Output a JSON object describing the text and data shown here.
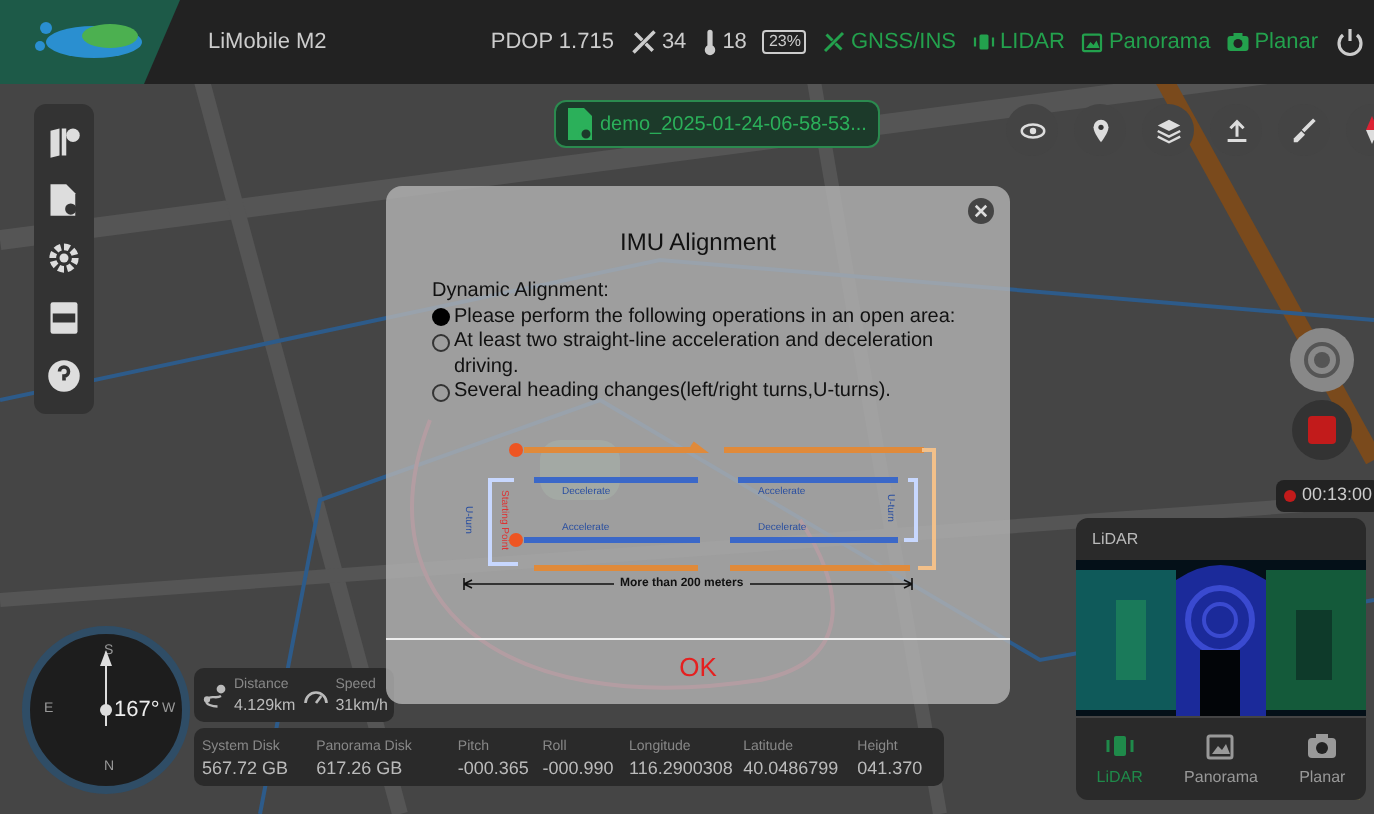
{
  "top_bar": {
    "device": "LiMobile M2",
    "pdop": "PDOP 1.715",
    "satellites": "34",
    "temperature": "18",
    "battery": "23%",
    "modes": [
      {
        "label": "GNSS/INS"
      },
      {
        "label": "LIDAR"
      },
      {
        "label": "Panorama"
      },
      {
        "label": "Planar"
      }
    ]
  },
  "file_chip": "demo_2025-01-24-06-58-53...",
  "recording": {
    "time": "00:13:00"
  },
  "dialog": {
    "title": "IMU Alignment",
    "heading": "Dynamic Alignment:",
    "items": [
      {
        "text": "Please perform the following operations in an open area:",
        "selected": true
      },
      {
        "text": "At least two straight-line acceleration and deceleration driving.",
        "selected": false
      },
      {
        "text": "Several heading changes(left/right turns,U-turns).",
        "selected": false
      }
    ],
    "diagram_labels": {
      "row_2_left": "Decelerate",
      "row_2_right": "Accelerate",
      "row_3_left": "Accelerate",
      "row_3_right": "Decelerate",
      "left_turn": "U-turn",
      "start": "Starting Point",
      "right_turn": "U-turn",
      "distance": "More than 200 meters"
    },
    "button": "OK"
  },
  "compass": {
    "heading": "167°",
    "cardinals": [
      "S",
      "E",
      "W",
      "N"
    ]
  },
  "trip": {
    "distance_label": "Distance",
    "distance": "4.129km",
    "speed_label": "Speed",
    "speed": "31km/h"
  },
  "stats": [
    {
      "label": "System Disk",
      "value": "567.72 GB"
    },
    {
      "label": "Panorama Disk",
      "value": "617.26 GB"
    },
    {
      "label": "Pitch",
      "value": "-000.365"
    },
    {
      "label": "Roll",
      "value": "-000.990"
    },
    {
      "label": "Longitude",
      "value": "116.2900308"
    },
    {
      "label": "Latitude",
      "value": "40.0486799"
    },
    {
      "label": "Height",
      "value": "041.370"
    }
  ],
  "lidar_panel": {
    "title": "LiDAR",
    "tabs": [
      {
        "label": "LiDAR",
        "selected": true
      },
      {
        "label": "Panorama",
        "selected": false
      },
      {
        "label": "Planar",
        "selected": false
      }
    ]
  }
}
